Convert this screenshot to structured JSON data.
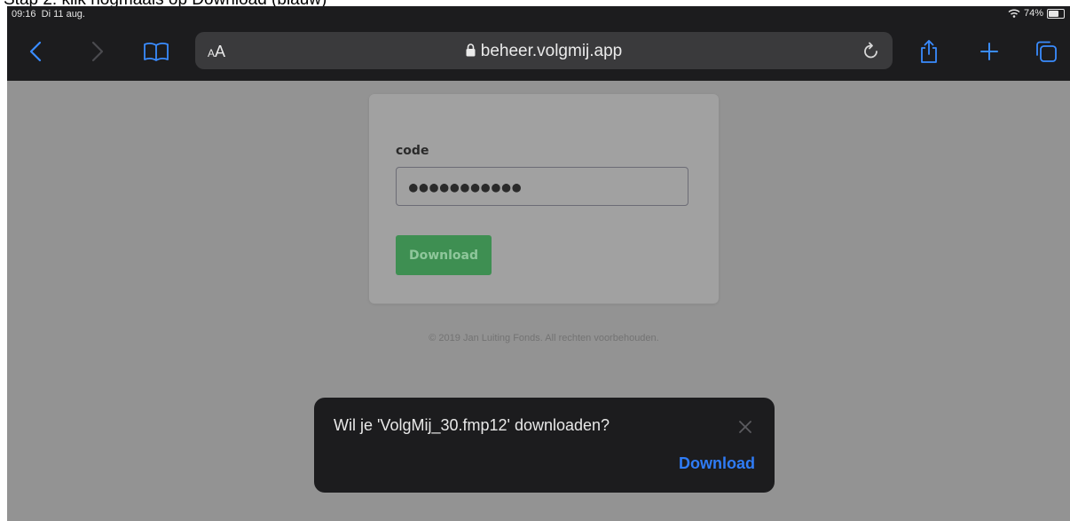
{
  "caption": "Stap 2: klik nogmaals op Download (blauw)",
  "status_bar": {
    "time": "09:16",
    "date": "Di 11 aug.",
    "battery": "74%",
    "battery_level": 0.74
  },
  "toolbar": {
    "text_size_label": "AA",
    "url": "beheer.volgmij.app",
    "icons": [
      "back-icon",
      "forward-icon",
      "bookmarks-icon",
      "lock-icon",
      "reload-icon",
      "share-icon",
      "new-tab-icon",
      "tabs-icon"
    ]
  },
  "form": {
    "label": "code",
    "input_value": "●●●●●●●●●●●",
    "button_label": "Download"
  },
  "footer": "© 2019 Jan Luiting Fonds. All rechten voorbehouden.",
  "popup": {
    "message": "Wil je 'VolgMij_30.fmp12' downloaden?",
    "download_label": "Download"
  },
  "colors": {
    "page_dim": "#939393",
    "accent": "#2f7cf6",
    "form_button": "#3e8f52",
    "toolbar": "#1c1c1e"
  }
}
